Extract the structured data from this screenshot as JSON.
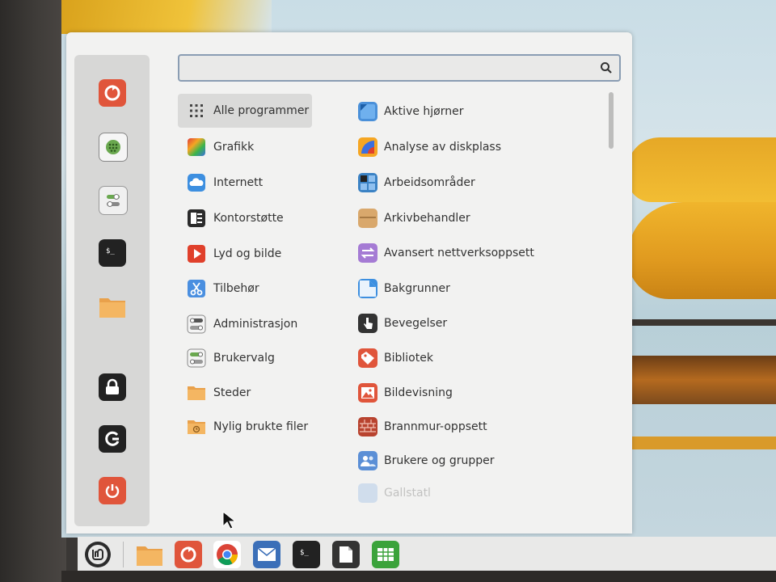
{
  "search": {
    "placeholder": "",
    "value": ""
  },
  "favorites": [
    {
      "name": "Oppdateringshåndterer",
      "icon": "update-manager-icon"
    },
    {
      "name": "Programvarehåndterer",
      "icon": "software-manager-icon"
    },
    {
      "name": "Innstillinger",
      "icon": "settings-icon"
    },
    {
      "name": "Terminal",
      "icon": "terminal-icon"
    },
    {
      "name": "Filer",
      "icon": "folder-icon"
    }
  ],
  "session": [
    {
      "name": "Lås skjerm",
      "icon": "lock-icon"
    },
    {
      "name": "Logg ut",
      "icon": "logout-icon"
    },
    {
      "name": "Avslutt",
      "icon": "power-icon"
    }
  ],
  "categories": [
    {
      "label": "Alle programmer",
      "icon": "grid-icon",
      "selected": true
    },
    {
      "label": "Grafikk",
      "icon": "graphics-icon"
    },
    {
      "label": "Internett",
      "icon": "cloud-icon"
    },
    {
      "label": "Kontorstøtte",
      "icon": "office-icon"
    },
    {
      "label": "Lyd og bilde",
      "icon": "play-icon"
    },
    {
      "label": "Tilbehør",
      "icon": "scissors-icon"
    },
    {
      "label": "Administrasjon",
      "icon": "toggle-icon"
    },
    {
      "label": "Brukervalg",
      "icon": "toggle-icon"
    },
    {
      "label": "Steder",
      "icon": "folder-icon"
    },
    {
      "label": "Nylig brukte filer",
      "icon": "recent-folder-icon"
    }
  ],
  "apps": [
    {
      "label": "Aktive hjørner",
      "icon": "hot-corner-icon",
      "color": "#4a90d9"
    },
    {
      "label": "Analyse av diskplass",
      "icon": "disk-usage-icon",
      "color": "#f5a623"
    },
    {
      "label": "Arbeidsområder",
      "icon": "workspaces-icon",
      "color": "#3b82c4"
    },
    {
      "label": "Arkivbehandler",
      "icon": "archive-icon",
      "color": "#d9a86c"
    },
    {
      "label": "Avansert nettverksoppsett",
      "icon": "network-icon",
      "color": "#a57bd4"
    },
    {
      "label": "Bakgrunner",
      "icon": "backgrounds-icon",
      "color": "#3d8fe0"
    },
    {
      "label": "Bevegelser",
      "icon": "gestures-icon",
      "color": "#333333"
    },
    {
      "label": "Bibliotek",
      "icon": "library-icon",
      "color": "#e0553b"
    },
    {
      "label": "Bildevisning",
      "icon": "image-viewer-icon",
      "color": "#e0553b"
    },
    {
      "label": "Brannmur-oppsett",
      "icon": "firewall-icon",
      "color": "#b8432f"
    },
    {
      "label": "Brukere og grupper",
      "icon": "users-icon",
      "color": "#5b8fd6"
    },
    {
      "label": "Gallstatl",
      "icon": "faded-icon",
      "color": "#6fa0e0"
    }
  ],
  "taskbar": [
    {
      "name": "Meny",
      "icon": "mint-logo-icon"
    },
    {
      "name": "Filer",
      "icon": "folder-icon"
    },
    {
      "name": "Oppdateringshåndterer",
      "icon": "update-manager-icon"
    },
    {
      "name": "Chromium",
      "icon": "chrome-icon"
    },
    {
      "name": "E-post",
      "icon": "mail-icon"
    },
    {
      "name": "Terminal",
      "icon": "terminal-icon"
    },
    {
      "name": "Tekstbehandler",
      "icon": "document-icon"
    },
    {
      "name": "Regneark",
      "icon": "spreadsheet-icon"
    }
  ]
}
